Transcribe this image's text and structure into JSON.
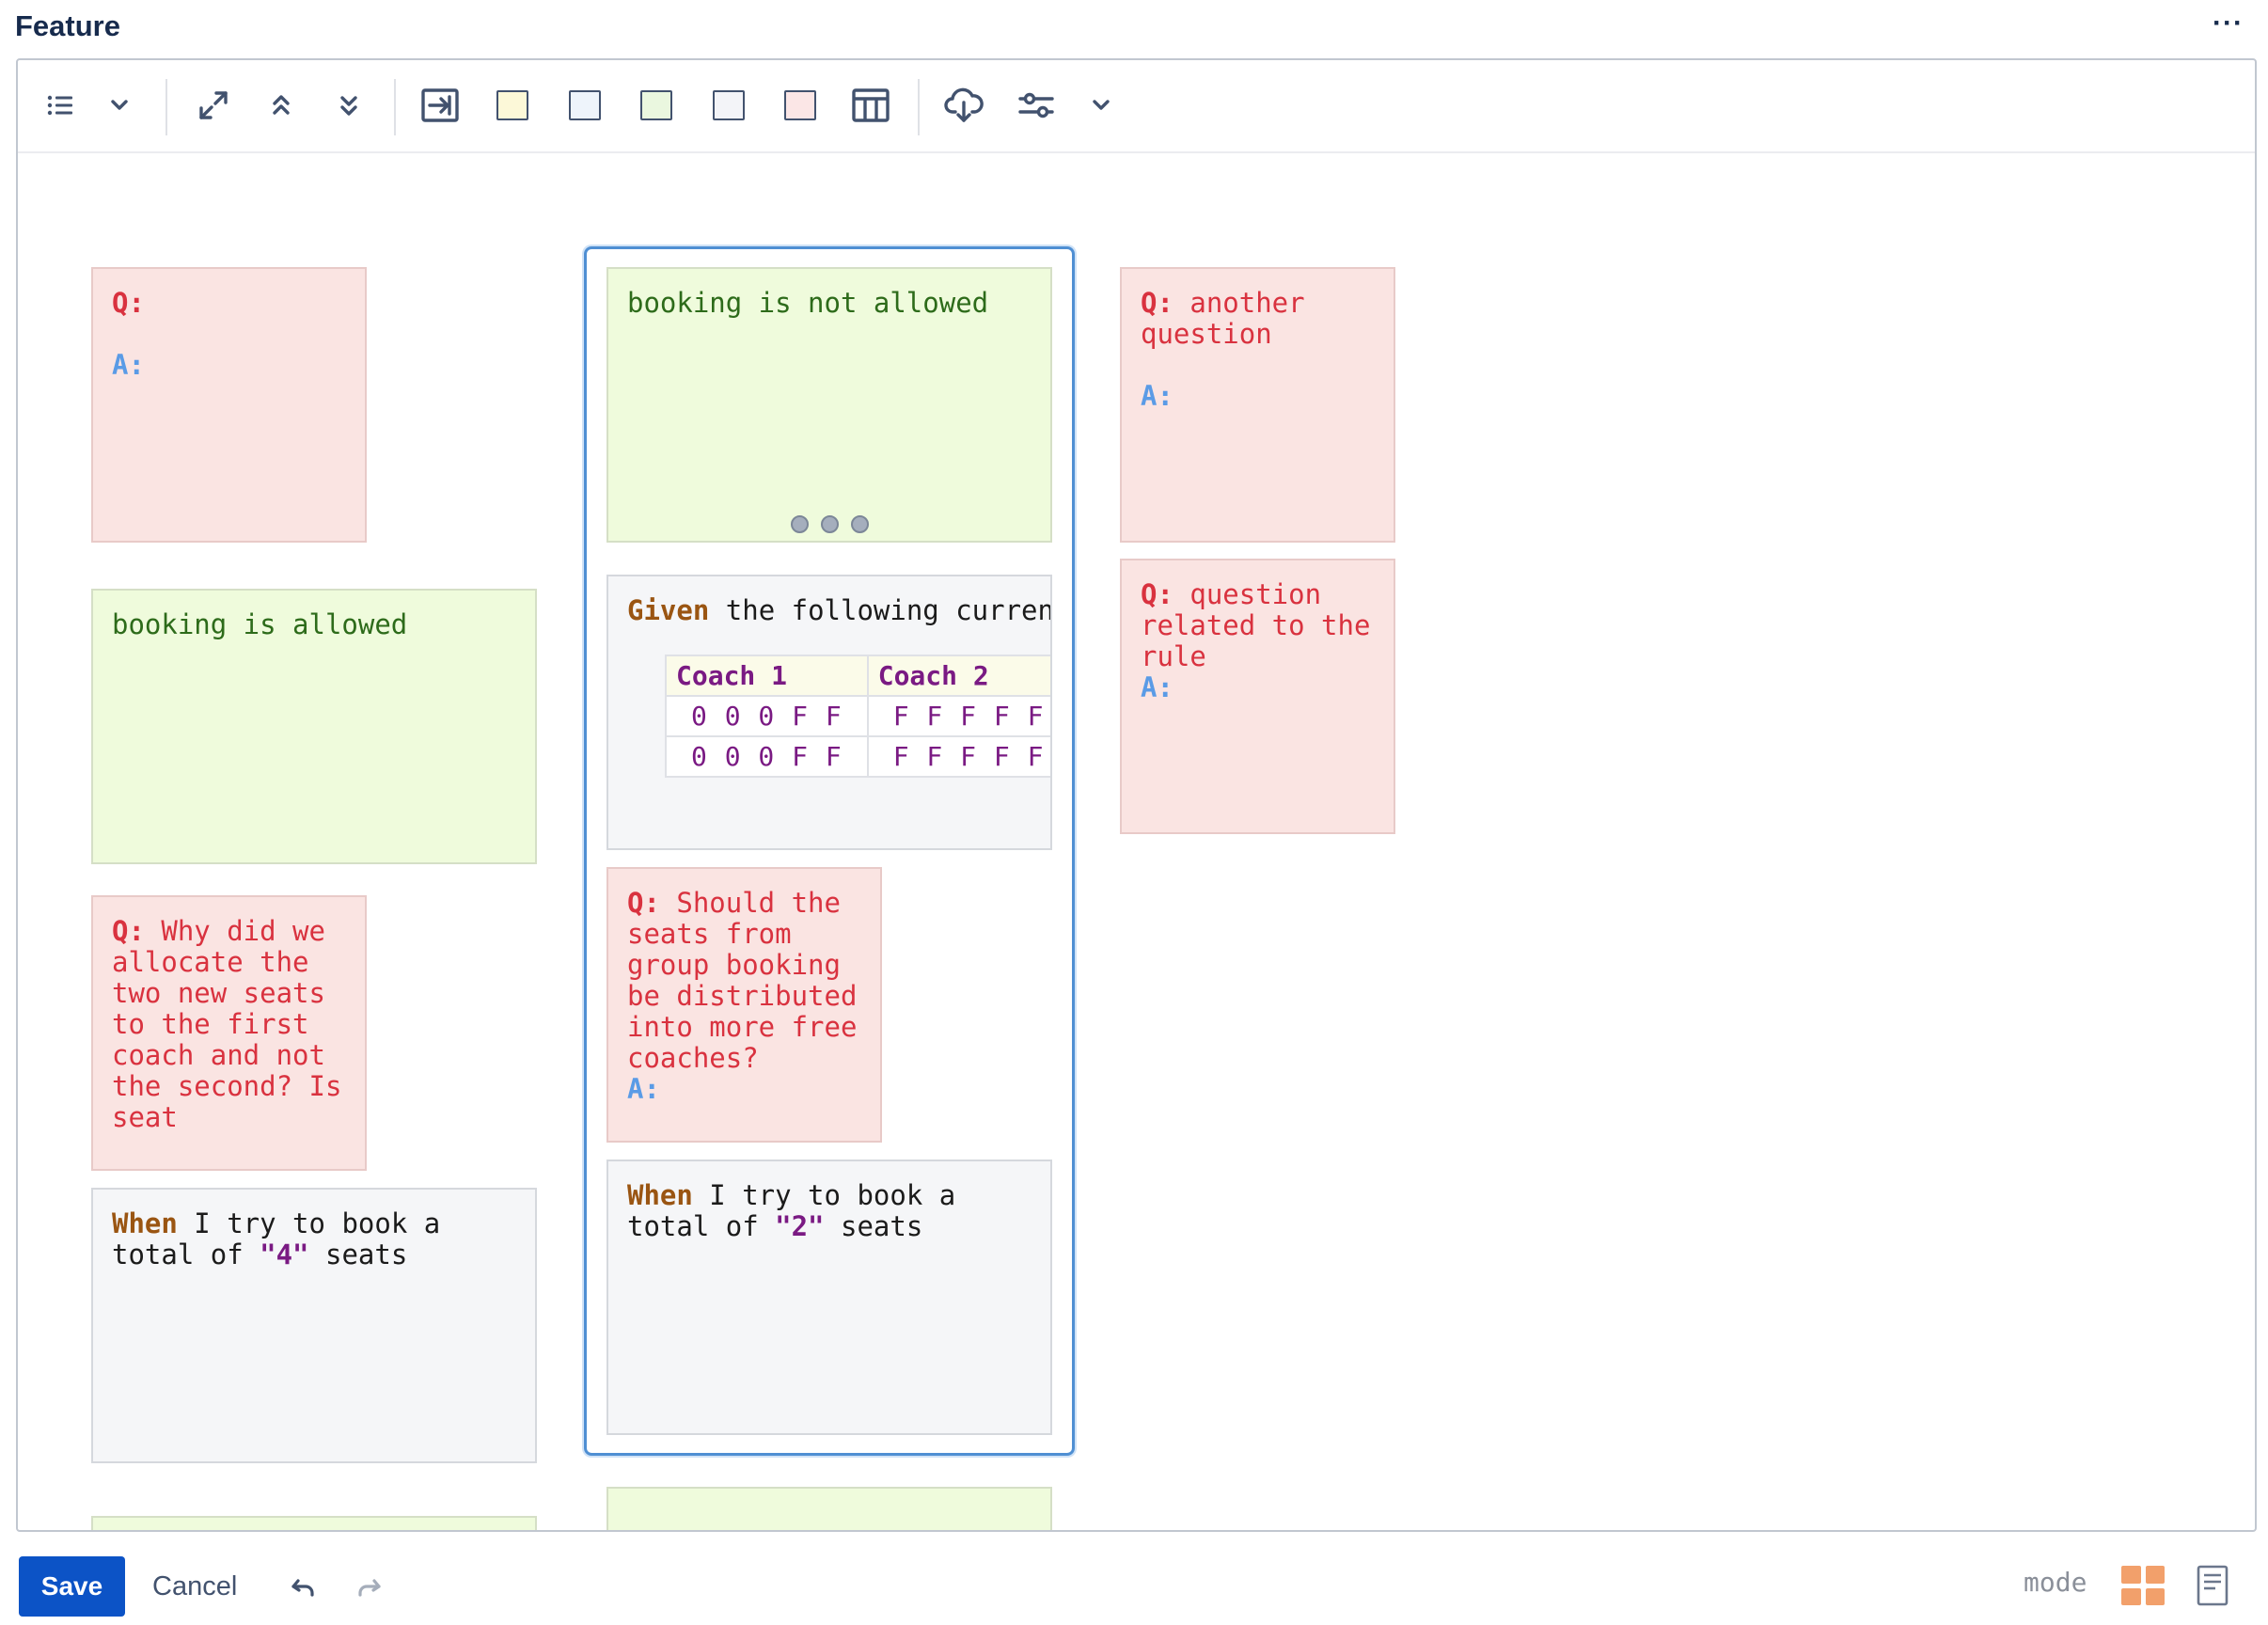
{
  "header": {
    "title": "Feature",
    "more_label": "···"
  },
  "toolbar": {
    "items": [
      "list-icon",
      "chevron-down-icon",
      "expand-icon",
      "collapse-up-icon",
      "collapse-down-icon",
      "insert-step-icon",
      "yellow-sticky-swatch",
      "blue-sticky-swatch",
      "green-sticky-swatch",
      "white-sticky-swatch",
      "pink-sticky-swatch",
      "table-icon",
      "cloud-download-icon",
      "settings-sliders-icon",
      "chevron-down-icon"
    ],
    "swatch_colors": {
      "yellow": "#fcf8d8",
      "blue": "#eef4fb",
      "green": "#eaf7df",
      "white": "#f3f4f8",
      "pink": "#fbe6e6"
    }
  },
  "stickies": {
    "q_empty": {
      "q": "Q:",
      "a": "A:"
    },
    "rule_allowed": {
      "text": "booking is allowed"
    },
    "q_why": {
      "q": "Q:",
      "text": " Why did we allocate the two new seats to the first coach and not the second? Is seat"
    },
    "when_4": {
      "kw": "When",
      "pre": " I try to book a total of ",
      "val": "\"4\"",
      "post": " seats"
    },
    "rule_not_allowed": {
      "text": "booking is not allowed"
    },
    "given": {
      "kw": "Given",
      "text": " the following curren",
      "table": {
        "headers": [
          "Coach 1",
          "Coach 2"
        ],
        "rows": [
          [
            "0 0 0 F F",
            "F F F F F"
          ],
          [
            "0 0 0 F F",
            "F F F F F"
          ]
        ]
      }
    },
    "q_distribute": {
      "q": "Q:",
      "text": " Should the seats from group booking be distributed into more free coaches?",
      "a": "A:"
    },
    "when_2": {
      "kw": "When",
      "pre": " I try to book a total of ",
      "val": "\"2\"",
      "post": " seats"
    },
    "q_another": {
      "q": "Q:",
      "text": " another question",
      "a": "A:"
    },
    "q_related": {
      "q": "Q:",
      "text": " question related to the rule",
      "a": "A:"
    }
  },
  "footer": {
    "save_label": "Save",
    "cancel_label": "Cancel",
    "mode_label": "mode",
    "mode_active_color": "#f2a06b"
  }
}
